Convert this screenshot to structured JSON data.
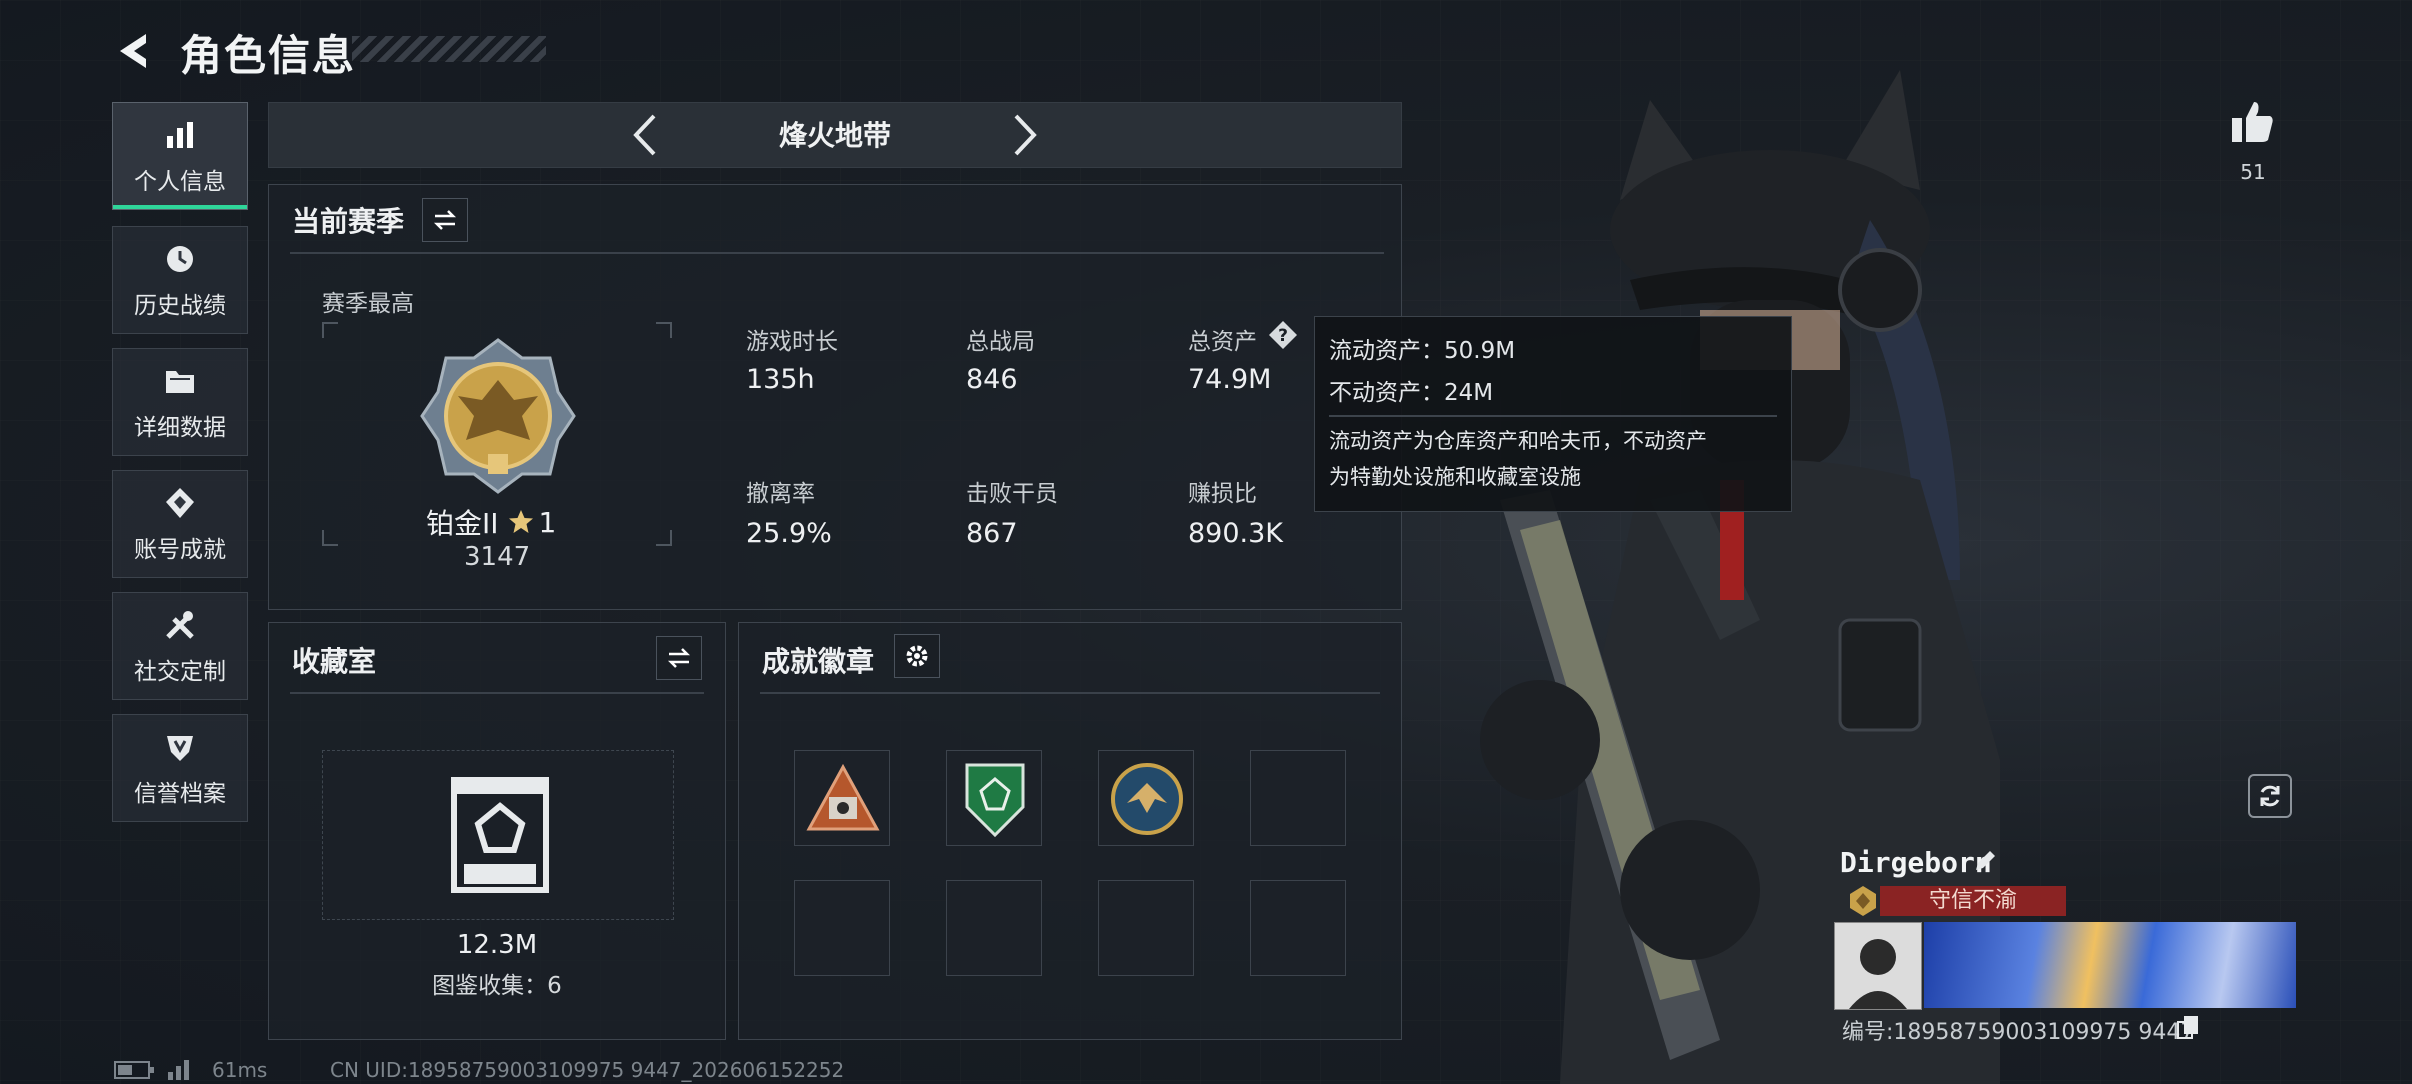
{
  "header": {
    "title": "角色信息"
  },
  "sidebar": {
    "items": [
      {
        "label": "个人信息",
        "icon": "bar-chart-icon",
        "active": true
      },
      {
        "label": "历史战绩",
        "icon": "clock-history-icon",
        "active": false
      },
      {
        "label": "详细数据",
        "icon": "folder-icon",
        "active": false
      },
      {
        "label": "账号成就",
        "icon": "achievement-icon",
        "active": false
      },
      {
        "label": "社交定制",
        "icon": "tools-icon",
        "active": false
      },
      {
        "label": "信誉档案",
        "icon": "credit-shield-icon",
        "active": false
      }
    ]
  },
  "mode_bar": {
    "title": "烽火地带"
  },
  "season": {
    "title": "当前赛季",
    "best_label": "赛季最高",
    "rank_name": "铂金II",
    "rank_stars": "1",
    "rank_score": "3147",
    "stats": [
      {
        "label": "游戏时长",
        "value": "135h"
      },
      {
        "label": "总战局",
        "value": "846"
      },
      {
        "label": "总资产",
        "value": "74.9M"
      },
      {
        "label": "撤离率",
        "value": "25.9%"
      },
      {
        "label": "击败干员",
        "value": "867"
      },
      {
        "label": "赚损比",
        "value": "890.3K"
      }
    ]
  },
  "tooltip": {
    "liquid": "流动资产：50.9M",
    "fixed": "不动资产：24M",
    "desc_line1": "流动资产为仓库资产和哈夫币，不动资产",
    "desc_line2": "为特勤处设施和收藏室设施"
  },
  "collection": {
    "title": "收藏室",
    "value": "12.3M",
    "catalog": "图鉴收集：6"
  },
  "badges": {
    "title": "成就徽章",
    "slots": [
      {
        "name": "triangle-badge",
        "filled": true
      },
      {
        "name": "green-shield-badge",
        "filled": true
      },
      {
        "name": "eagle-coin-badge",
        "filled": true
      },
      {
        "name": "empty",
        "filled": false
      },
      {
        "name": "empty",
        "filled": false
      },
      {
        "name": "empty",
        "filled": false
      },
      {
        "name": "empty",
        "filled": false
      },
      {
        "name": "empty",
        "filled": false
      }
    ]
  },
  "likes": {
    "count": "51"
  },
  "player": {
    "name": "Dirgeborn",
    "honor": "守信不渝",
    "id": "编号:18958759003109975 9447"
  },
  "status_bar": {
    "ping": "61ms",
    "uid": "CN UID:18958759003109975 9447_202606152252"
  },
  "colors": {
    "accent": "#2fd69a",
    "honor_red": "#8a2323",
    "gold": "#c9a24a"
  }
}
